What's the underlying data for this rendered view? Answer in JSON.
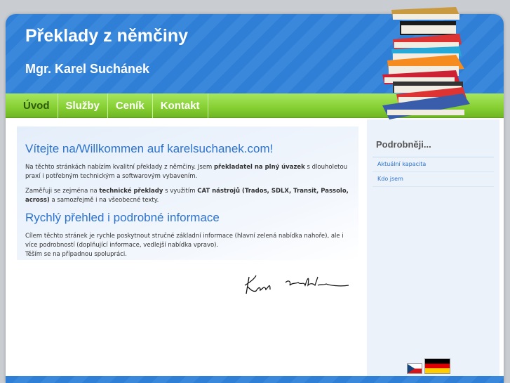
{
  "header": {
    "title": "Překlady z němčiny",
    "subtitle": "Mgr. Karel Suchánek"
  },
  "nav": {
    "items": [
      {
        "label": "Úvod",
        "active": true
      },
      {
        "label": "Služby"
      },
      {
        "label": "Ceník"
      },
      {
        "label": "Kontakt"
      }
    ]
  },
  "main": {
    "heading1": "Vítejte na/Willkommen auf karelsuchanek.com!",
    "p1_a": "Na těchto stránkách nabízím kvalitní překlady z němčiny. Jsem ",
    "p1_b": "překladatel na plný úvazek",
    "p1_c": " s dlouholetou praxí i potřebným technickým a softwarovým vybavením.",
    "p2_a": "Zaměřuji se zejména na ",
    "p2_b": "technické překlady",
    "p2_c": " s využitím ",
    "p2_d": "CAT nástrojů (Trados, SDLX, Transit, Passolo, across)",
    "p2_e": " a samozřejmě i na všeobecné texty.",
    "heading2": "Rychlý přehled i podrobné informace",
    "p3_a": "Cílem těchto stránek je rychle poskytnout stručné základní informace (hlavní zelená nabídka nahoře), ale i více podrobností (doplňující informace, vedlejší nabídka vpravo).",
    "p3_b": "Těším se na případnou spolupráci.",
    "signature": "Karel Suchánek"
  },
  "sidebar": {
    "title": "Podrobněji...",
    "links": [
      "Aktuální kapacita",
      "Kdo jsem"
    ]
  },
  "colors": {
    "blue": "#2f7fd6",
    "green": "#86cf32",
    "link": "#2b73cf"
  }
}
